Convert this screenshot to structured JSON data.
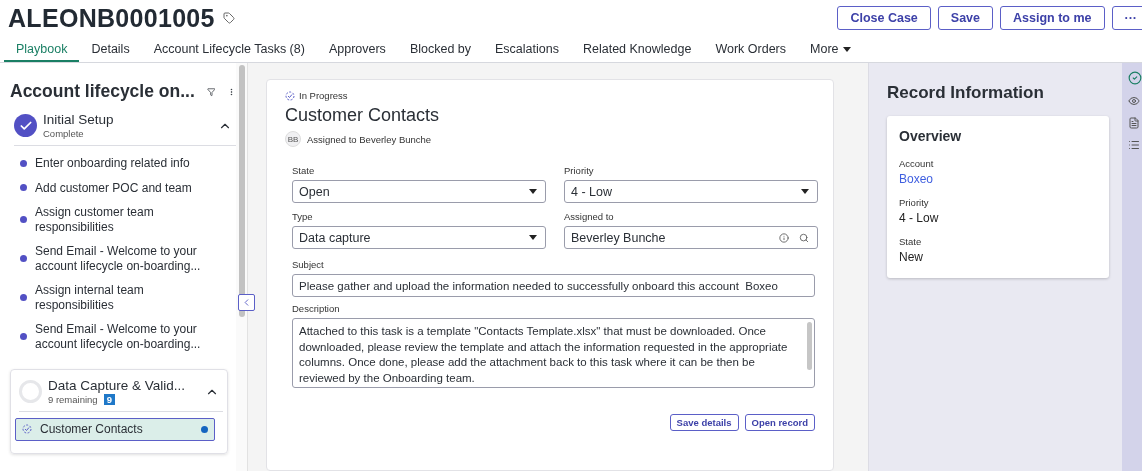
{
  "record": {
    "number": "ALEONB0001005"
  },
  "actions": [
    {
      "label": "Close Case"
    },
    {
      "label": "Save"
    },
    {
      "label": "Assign to me"
    },
    {
      "label": "···"
    }
  ],
  "tabs": [
    {
      "label": "Playbook",
      "selected": true,
      "kind": "tab"
    },
    {
      "label": "Details",
      "selected": false,
      "kind": "tab"
    },
    {
      "label": "Account Lifecycle Tasks (8)",
      "selected": false,
      "kind": "tab"
    },
    {
      "label": "Approvers",
      "selected": false,
      "kind": "tab"
    },
    {
      "label": "Blocked by",
      "selected": false,
      "kind": "tab"
    },
    {
      "label": "Escalations",
      "selected": false,
      "kind": "tab"
    },
    {
      "label": "Related Knowledge",
      "selected": false,
      "kind": "tab"
    },
    {
      "label": "Work Orders",
      "selected": false,
      "kind": "tab"
    },
    {
      "label": "More",
      "selected": false,
      "kind": "menu"
    }
  ],
  "playbook": {
    "title": "Account lifecycle on...",
    "stages": [
      {
        "title": "Initial Setup",
        "status": "Complete",
        "complete": true,
        "expanded": true,
        "tasks": [
          {
            "label": "Enter onboarding related info",
            "kind": "done",
            "selected": false
          },
          {
            "label": "Add customer POC and team",
            "kind": "done",
            "selected": false
          },
          {
            "label": "Assign customer team responsibilities",
            "kind": "done",
            "selected": false
          },
          {
            "label": "Send Email - Welcome to your account lifecycle on-boarding...",
            "kind": "done",
            "selected": false
          },
          {
            "label": "Assign internal team responsibilities",
            "kind": "done",
            "selected": false
          },
          {
            "label": "Send Email - Welcome to your account lifecycle on-boarding...",
            "kind": "done",
            "selected": false
          }
        ]
      },
      {
        "title": "Data Capture & Valid...",
        "status": "9 remaining",
        "badge": "9",
        "complete": false,
        "expanded": true,
        "tasks": [
          {
            "label": "Customer Contacts",
            "kind": "in_progress",
            "selected": true
          }
        ]
      }
    ]
  },
  "task": {
    "status": "In Progress",
    "title": "Customer Contacts",
    "avatar": "BB",
    "assignee": "Assigned to Beverley Bunche",
    "fields": [
      {
        "label": "State",
        "value": "Open",
        "kind": "select"
      },
      {
        "label": "Priority",
        "value": "4 - Low",
        "kind": "select"
      },
      {
        "label": "Type",
        "value": "Data capture",
        "kind": "select"
      },
      {
        "label": "Assigned to",
        "value": "Beverley Bunche",
        "kind": "reference"
      }
    ],
    "subject": {
      "label": "Subject",
      "value": "Please gather and upload the information needed to successfully onboard this account  Boxeo"
    },
    "description": {
      "label": "Description",
      "value": "Attached to this task is a template \"Contacts Template.xlsx\" that must be downloaded. Once downloaded, please review the template and attach the information requested in the appropriate columns. Once done, please add the attachment back to this task where it can be then be reviewed by the Onboarding team."
    },
    "buttons": [
      {
        "label": "Save details"
      },
      {
        "label": "Open record"
      }
    ]
  },
  "record_info": {
    "title": "Record Information",
    "card_title": "Overview",
    "items": [
      {
        "label": "Account",
        "value": "Boxeo",
        "kind": "link"
      },
      {
        "label": "Priority",
        "value": "4 - Low",
        "kind": "text"
      },
      {
        "label": "State",
        "value": "New",
        "kind": "text"
      }
    ]
  }
}
